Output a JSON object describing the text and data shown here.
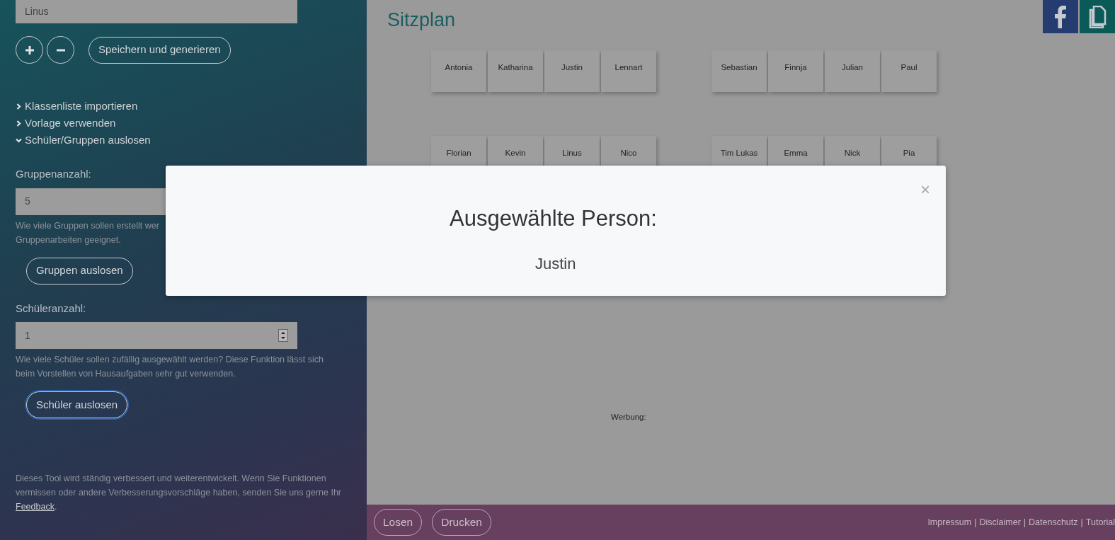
{
  "sidebar": {
    "name_field": {
      "value": "Linus"
    },
    "icon_buttons": [
      {
        "kind": "plus"
      },
      {
        "kind": "minus"
      }
    ],
    "save_button": "Speichern und generieren",
    "sections": [
      {
        "label": "Klassenliste importieren",
        "expanded": false
      },
      {
        "label": "Vorlage verwenden",
        "expanded": false
      },
      {
        "label": "Schüler/Gruppen auslosen",
        "expanded": true
      }
    ],
    "group_count": {
      "label": "Gruppenanzahl:",
      "value": "5",
      "hint_lines": [
        "Wie viele Gruppen sollen erstellt wer",
        "Gruppenarbeiten geeignet."
      ]
    },
    "group_button": {
      "label": "Gruppen auslosen",
      "focused": false
    },
    "student_count": {
      "label": "Schüleranzahl:",
      "value": "1",
      "hint": "Wie viele Schüler sollen zufällig ausgewählt werden? Diese Funktion lässt sich beim Vorstellen von Hausaufgaben sehr gut verwenden."
    },
    "student_button": {
      "label": "Schüler auslosen",
      "focused": true
    },
    "info_text": "Dieses Tool wird ständig verbessert und weiterentwickelt. Wenn Sie Funktionen vermissen oder andere Verbesserungsvorschläge haben, senden Sie uns gerne Ihr",
    "feedback_link": "Feedback",
    "info_end": "."
  },
  "main": {
    "title": "Sitzplan",
    "share_buttons": [
      {
        "kind": "facebook"
      },
      {
        "kind": "copy"
      }
    ],
    "desk_rows": [
      {
        "groups": [
          [
            "Antonia",
            "Katharina",
            "Justin",
            "Lennart"
          ],
          [
            "Sebastian",
            "Finnja",
            "Julian",
            "Paul"
          ]
        ]
      },
      {
        "groups": [
          [
            "Florian",
            "Kevin",
            "Linus",
            "Nico"
          ],
          [
            "Tim Lukas",
            "Emma",
            "Nick",
            "Pia"
          ]
        ]
      }
    ],
    "ad_label": "Werbung:"
  },
  "footer": {
    "buttons": [
      "Losen",
      "Drucken"
    ],
    "links": [
      "Impressum",
      "Disclaimer",
      "Datenschutz",
      "Tutorial"
    ],
    "separator": "|"
  },
  "modal": {
    "title": "Ausgewählte Person:",
    "value": "Justin",
    "close": "×"
  }
}
